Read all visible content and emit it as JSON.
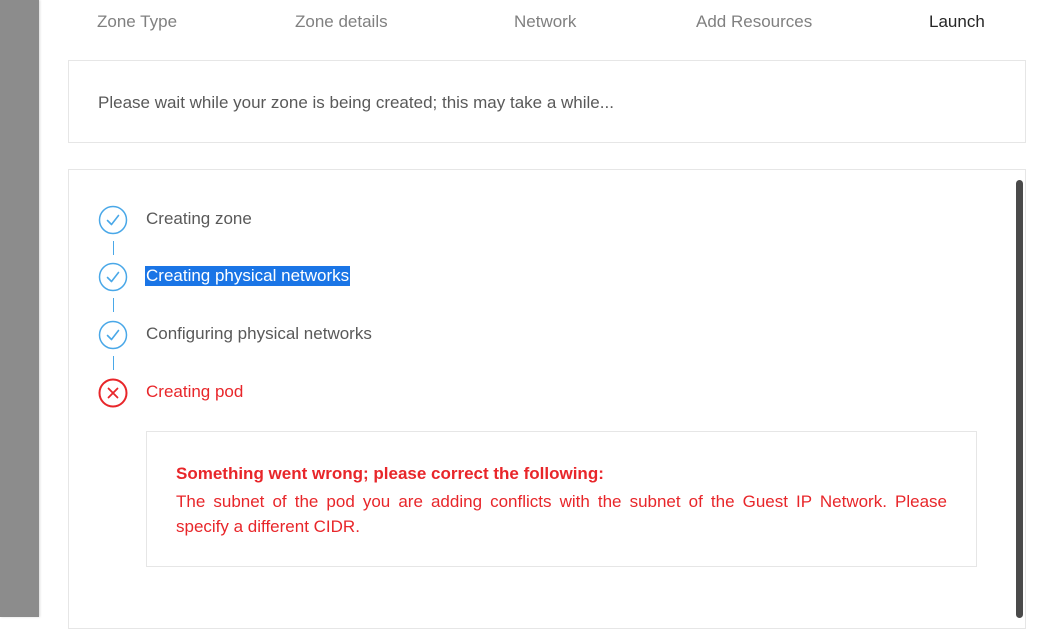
{
  "steps": {
    "items": [
      {
        "label": "Zone Type"
      },
      {
        "label": "Zone details"
      },
      {
        "label": "Network"
      },
      {
        "label": "Add Resources"
      },
      {
        "label": "Launch"
      }
    ]
  },
  "wait": {
    "message": "Please wait while your zone is being created; this may take a while..."
  },
  "tasks": [
    {
      "label": "Creating zone",
      "status": "done",
      "icon": "check-circle-icon"
    },
    {
      "label": "Creating physical networks",
      "status": "done",
      "icon": "check-circle-icon"
    },
    {
      "label": "Configuring physical networks",
      "status": "done",
      "icon": "check-circle-icon"
    },
    {
      "label": "Creating pod",
      "status": "error",
      "icon": "close-circle-icon"
    }
  ],
  "error": {
    "title": "Something went wrong; please correct the following:",
    "message": "The subnet of the pod you are adding conflicts with the subnet of the Guest IP Network. Please specify a different CIDR."
  },
  "colors": {
    "success": "#4aa8e8",
    "error": "#e8262a",
    "selection": "#1a75e6",
    "overlay": "#8c8c8c"
  }
}
